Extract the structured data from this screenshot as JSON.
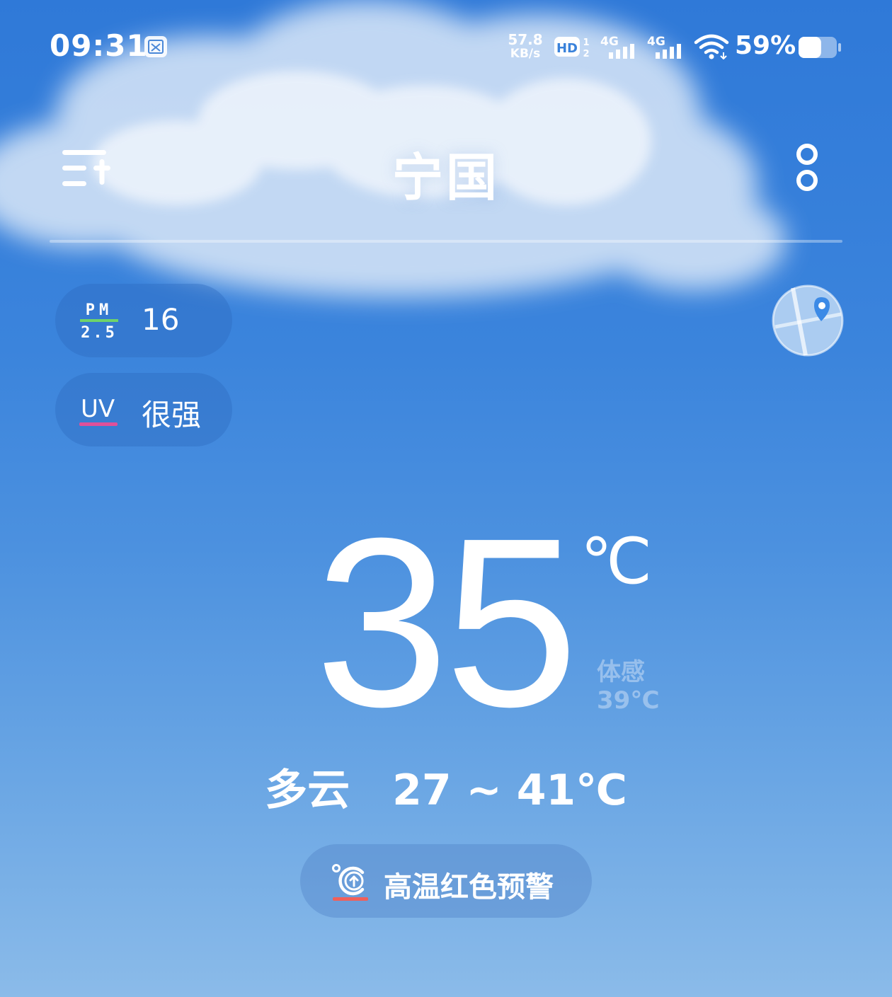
{
  "status_bar": {
    "time": "09:31",
    "net_speed_value": "57.8",
    "net_speed_unit": "KB/s",
    "network1": "4G",
    "network2": "4G",
    "battery_percent": "59%",
    "battery_level": 0.59
  },
  "header": {
    "city": "宁国"
  },
  "air_quality": {
    "pm_label_top": "PM",
    "pm_label_bottom": "2.5",
    "pm_value": "16",
    "uv_label": "UV",
    "uv_value": "很强"
  },
  "current": {
    "temperature": "35",
    "unit": "℃",
    "feels_label": "体感",
    "feels_value": "39℃",
    "condition": "多云",
    "range": "27 ~ 41℃"
  },
  "alert": {
    "text": "高温红色预警"
  },
  "colors": {
    "pm_accent": "#6ed36a",
    "uv_accent": "#e0509a",
    "alert_accent": "#f0605a",
    "map_pin": "#3c8ae6"
  }
}
